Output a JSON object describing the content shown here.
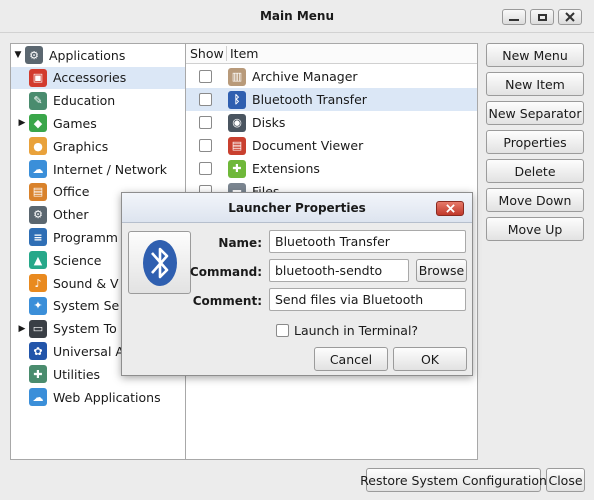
{
  "window": {
    "title": "Main Menu"
  },
  "categories": [
    {
      "label": "Applications",
      "expanded": true,
      "icon": "gear-icon",
      "color": "#5b6770"
    },
    {
      "label": "Accessories",
      "icon": "toolbox-icon",
      "color": "#d23b2e"
    },
    {
      "label": "Education",
      "icon": "education-icon",
      "color": "#4a8c6e"
    },
    {
      "label": "Games",
      "collapsed": true,
      "icon": "gamepad-icon",
      "color": "#3aa64a"
    },
    {
      "label": "Graphics",
      "icon": "palette-icon",
      "color": "#e9a23b"
    },
    {
      "label": "Internet / Network",
      "icon": "cloud-icon",
      "color": "#3b8fd9"
    },
    {
      "label": "Office",
      "icon": "briefcase-icon",
      "color": "#d9822b"
    },
    {
      "label": "Other",
      "icon": "gear-icon",
      "color": "#5b6770"
    },
    {
      "label": "Programm",
      "icon": "code-icon",
      "color": "#2f6fb5"
    },
    {
      "label": "Science",
      "icon": "flask-icon",
      "color": "#27a88a"
    },
    {
      "label": "Sound & V",
      "icon": "music-icon",
      "color": "#e98a1f"
    },
    {
      "label": "System Se",
      "icon": "settings-icon",
      "color": "#3b8fd9"
    },
    {
      "label": "System To",
      "collapsed": true,
      "icon": "monitor-icon",
      "color": "#3a3f45"
    },
    {
      "label": "Universal A",
      "icon": "accessibility-icon",
      "color": "#2255aa"
    },
    {
      "label": "Utilities",
      "icon": "utilities-icon",
      "color": "#4a8c6e"
    },
    {
      "label": "Web Applications",
      "icon": "cloud-icon",
      "color": "#3b8fd9"
    }
  ],
  "list": {
    "headers": {
      "show": "Show",
      "item": "Item"
    },
    "items": [
      {
        "label": "Archive Manager",
        "icon": "archive-icon",
        "color": "#b89a7a"
      },
      {
        "label": "Bluetooth Transfer",
        "icon": "bluetooth-icon",
        "color": "#2f5fb0"
      },
      {
        "label": "Disks",
        "icon": "disk-icon",
        "color": "#4a5560"
      },
      {
        "label": "Document Viewer",
        "icon": "document-icon",
        "color": "#c9402f"
      },
      {
        "label": "Extensions",
        "icon": "puzzle-icon",
        "color": "#6fb83a"
      },
      {
        "label": "Files",
        "icon": "folder-icon",
        "color": "#7a8590"
      }
    ]
  },
  "side_buttons": {
    "new_menu": "New Menu",
    "new_item": "New Item",
    "new_separator": "New Separator",
    "properties": "Properties",
    "delete": "Delete",
    "move_down": "Move Down",
    "move_up": "Move Up"
  },
  "bottom_buttons": {
    "restore": "Restore System Configuration",
    "close": "Close"
  },
  "dialog": {
    "title": "Launcher Properties",
    "name_label": "Name:",
    "name_value": "Bluetooth Transfer",
    "command_label": "Command:",
    "command_value": "bluetooth-sendto",
    "browse": "Browse",
    "comment_label": "Comment:",
    "comment_value": "Send files via Bluetooth",
    "terminal_label": "Launch in Terminal?",
    "cancel": "Cancel",
    "ok": "OK"
  }
}
